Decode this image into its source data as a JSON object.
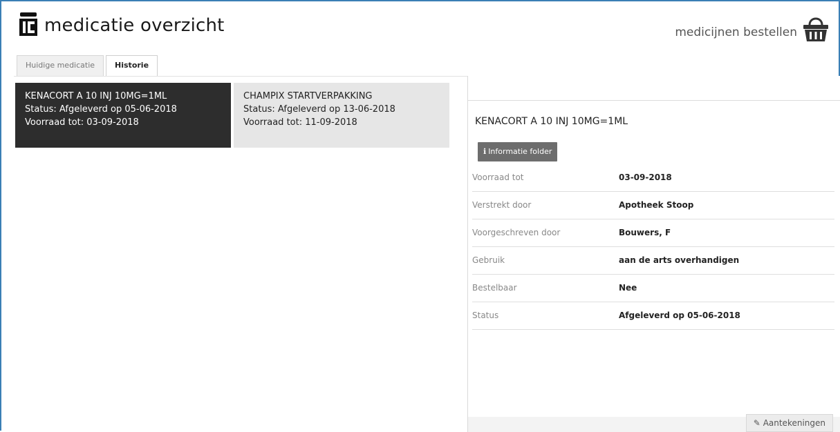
{
  "header": {
    "title": "medicatie overzicht",
    "order_link": "medicijnen bestellen"
  },
  "tabs": [
    {
      "label": "Huidige medicatie",
      "active": false
    },
    {
      "label": "Historie",
      "active": true
    }
  ],
  "medications": [
    {
      "name": "KENACORT A 10 INJ 10MG=1ML",
      "status": "Status: Afgeleverd op 05-06-2018",
      "stock": "Voorraad tot: 03-09-2018",
      "selected": true
    },
    {
      "name": "CHAMPIX STARTVERPAKKING",
      "status": "Status: Afgeleverd op 13-06-2018",
      "stock": "Voorraad tot: 11-09-2018",
      "selected": false
    }
  ],
  "detail": {
    "name": "KENACORT A 10 INJ 10MG=1ML",
    "info_button": "Informatie folder",
    "rows": [
      {
        "label": "Voorraad tot",
        "value": "03-09-2018"
      },
      {
        "label": "Verstrekt door",
        "value": "Apotheek Stoop"
      },
      {
        "label": "Voorgeschreven door",
        "value": "Bouwers, F"
      },
      {
        "label": "Gebruik",
        "value": "aan de arts overhandigen"
      },
      {
        "label": "Bestelbaar",
        "value": "Nee"
      },
      {
        "label": "Status",
        "value": "Afgeleverd op 05-06-2018"
      }
    ],
    "notes_button": "Aantekeningen"
  },
  "colors": {
    "frame_border": "#3a7fb5",
    "selected_card": "#2d2d2d",
    "unselected_card": "#e6e6e6",
    "info_button": "#6d6d6d"
  },
  "icons": [
    "pharmacy-logo-icon",
    "basket-icon",
    "info-icon",
    "edit-icon"
  ]
}
